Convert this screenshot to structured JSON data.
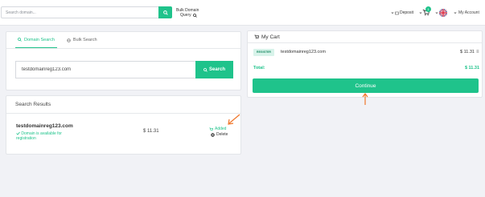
{
  "header": {
    "search_placeholder": "Search domain...",
    "bulk_label": "Bulk Domain",
    "query_label": "Query",
    "deposit_label": "Deposit",
    "cart_count": "1",
    "account_label": "My Account"
  },
  "search_panel": {
    "tabs": [
      {
        "label": "Domain Search",
        "icon": "search-icon"
      },
      {
        "label": "Bulk Search",
        "icon": "globe-icon"
      }
    ],
    "domain_value": "testdomainreg123.com",
    "search_button_label": "Search"
  },
  "results": {
    "title": "Search Results",
    "domain": "testdomainreg123.com",
    "availability": "Domain is available for registration",
    "price": "$ 11.31",
    "added_label": "Added",
    "delete_label": "Delete"
  },
  "cart": {
    "title": "My Cart",
    "item": {
      "badge": "REGISTER",
      "domain": "testdomainreg123.com",
      "price": "$ 11.31"
    },
    "total_label": "Total:",
    "total_value": "$ 11.31",
    "continue_label": "Continue"
  },
  "colors": {
    "accent": "#1fc38b",
    "annotation_arrow": "#f0762a"
  }
}
